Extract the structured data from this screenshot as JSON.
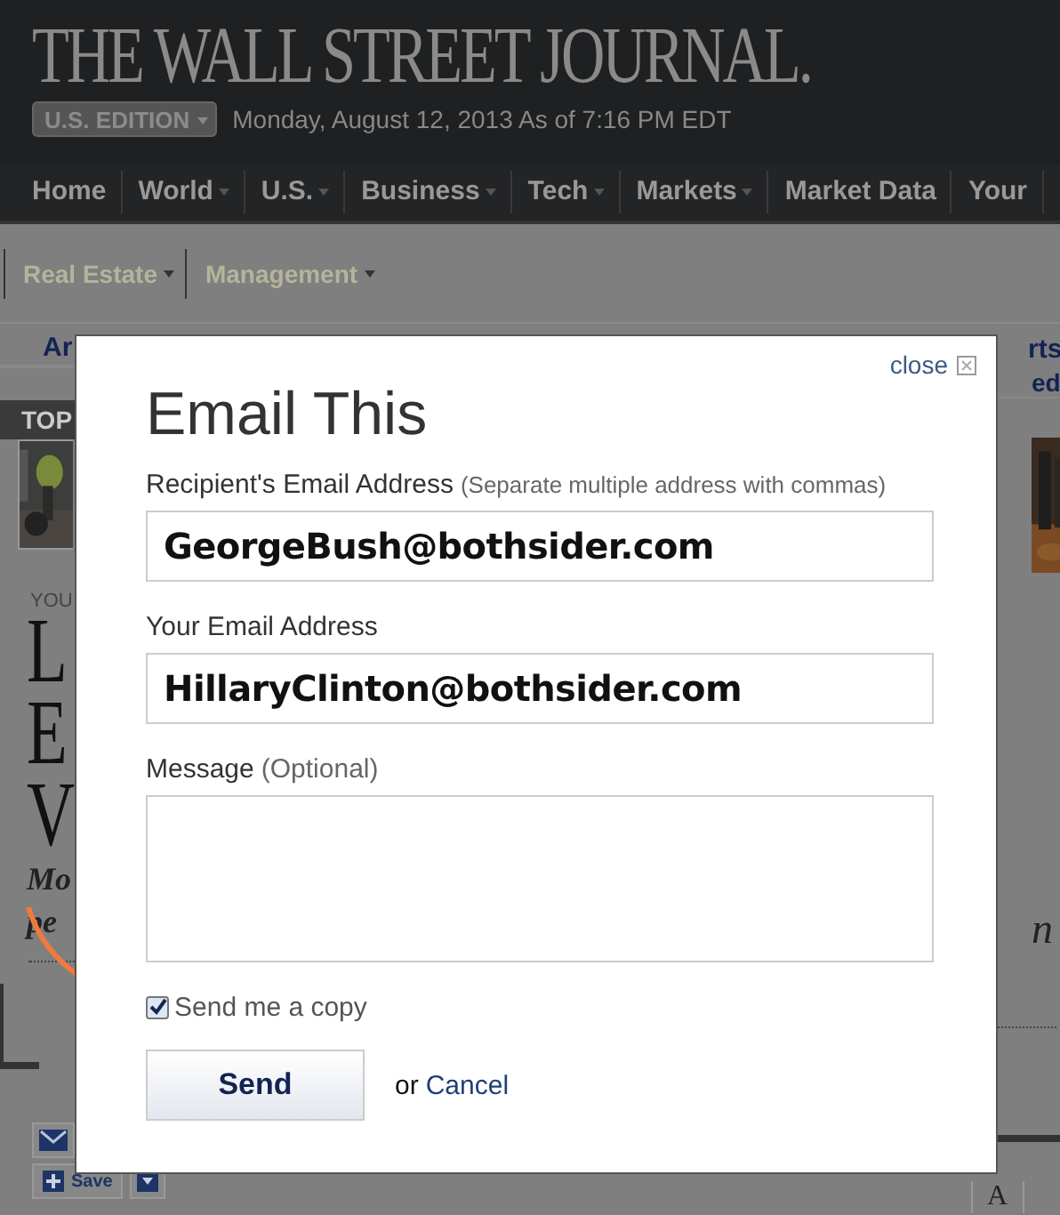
{
  "masthead": {
    "title": "THE WALL STREET JOURNAL.",
    "edition": "U.S. EDITION",
    "dateline": "Monday, August 12, 2013 As of 7:16 PM EDT"
  },
  "nav": [
    {
      "label": "Home",
      "dropdown": false
    },
    {
      "label": "World",
      "dropdown": true
    },
    {
      "label": "U.S.",
      "dropdown": true
    },
    {
      "label": "Business",
      "dropdown": true
    },
    {
      "label": "Tech",
      "dropdown": true
    },
    {
      "label": "Markets",
      "dropdown": true
    },
    {
      "label": "Market Data",
      "dropdown": false
    },
    {
      "label": "Your",
      "dropdown": false
    }
  ],
  "subnav": [
    {
      "label": "Real Estate",
      "dropdown": true
    },
    {
      "label": "Management",
      "dropdown": true
    }
  ],
  "background": {
    "left": {
      "tab_link": "Ar",
      "section_label": "TOP",
      "kicker": "YOU",
      "headline_letters": [
        "L",
        "E",
        "V"
      ],
      "deck_fragments": [
        "Mo",
        "pe"
      ],
      "save_button": "Save"
    },
    "right": {
      "tab_link": "rts",
      "label": "ed",
      "deck_fragment": "n",
      "text_size": "A"
    }
  },
  "dialog": {
    "close": "close",
    "title": "Email This",
    "fields": [
      {
        "kind": "input",
        "label": "Recipient's Email Address",
        "hint": "(Separate multiple address with commas)",
        "value": "GeorgeBush@bothsider.com"
      },
      {
        "kind": "input",
        "label": "Your Email Address",
        "value": "HillaryClinton@bothsider.com"
      },
      {
        "kind": "textarea",
        "label": "Message",
        "hint": "(Optional)"
      }
    ],
    "copy": {
      "label": "Send me a copy",
      "checked": true
    },
    "send": "Send",
    "or": "or",
    "cancel": "Cancel"
  }
}
